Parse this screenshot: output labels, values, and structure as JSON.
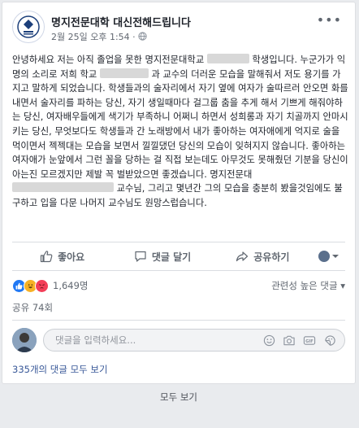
{
  "post": {
    "page_name": "명지전문대학 대신전해드립니다",
    "timestamp": "2월 25일 오후 1:54",
    "separator": "·",
    "text_parts": [
      "안녕하세요 저는 아직 졸업을 못한 명지전문대학교 ",
      " 학생입니다. 누군가가 익명의 소리로 저희 학교 ",
      " 과 교수의 더러운 모습을 말해줘서 저도 용기를 가지고 말하게 되었습니다. 학생들과의 술자리에서 자기 옆에 여자가 술따르러 안오면 화를 내면서 술자리를 파하는 당신, 자기 생일때마다 걸그룹 춤을 추게 해서 기쁘게 해줘야하는 당신, 여자배우들에게 색기가 부족하니 어쩌니 하면서 성희롱과 자기 치골까지 안마시키는 당신, 무엇보다도 학생들과 간 노래방에서 내가 좋아하는 여자애에게 억지로 술을 먹이면서 젝젝대는 모습을 보면서 낄낄댔던 당신의 모습이 잊혀지지 않습니다. 좋아하는 여자애가 눈앞에서 그런 꼴을 당하는 걸 직접 보는데도 아무것도 못해줬던 기분을 당신이 아는진 모르겠지만 제발 꼭 벌받았으면 좋겠습니다. 명지전문대 ",
      " 교수님, 그리고 몇년간 그의 모습을 충분히 봤을것임에도 불구하고 입을 다문 나머지 교수님도 원망스럽습니다."
    ]
  },
  "actions": {
    "like": "좋아요",
    "comment": "댓글 달기",
    "share": "공유하기"
  },
  "stats": {
    "reaction_count": "1,649명",
    "sort_label": "관련성 높은 댓글",
    "shares": "공유 74회"
  },
  "comment_box": {
    "placeholder": "댓글을 입력하세요..."
  },
  "view_comments": "335개의 댓글 모두 보기",
  "see_all": "모두 보기",
  "colors": {
    "link": "#385898",
    "like_blue": "#2078f4",
    "love_red": "#f33e58",
    "haha_yellow": "#f7b125"
  }
}
